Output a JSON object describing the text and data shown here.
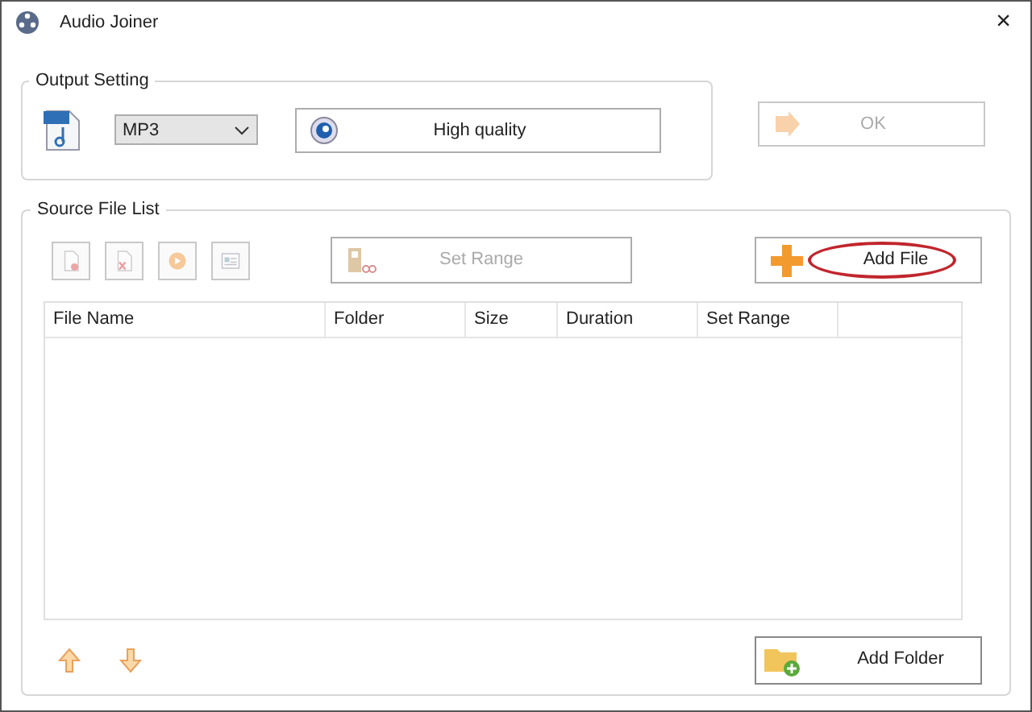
{
  "window": {
    "title": "Audio Joiner",
    "close": "×"
  },
  "output_setting": {
    "legend": "Output Setting",
    "format": "MP3",
    "quality_button": "High quality",
    "ok_button": {
      "label": "OK",
      "disabled": true
    }
  },
  "source_file_list": {
    "legend": "Source File List",
    "toolbar": [
      {
        "kind": "remove",
        "disabled": true
      },
      {
        "kind": "clear",
        "disabled": true
      },
      {
        "kind": "play",
        "disabled": true
      },
      {
        "kind": "properties",
        "disabled": true
      }
    ],
    "set_range_button": {
      "label": "Set Range",
      "disabled": true
    },
    "add_file_button": {
      "label": "Add File",
      "highlighted": true
    },
    "table": {
      "columns": [
        "File Name",
        "Folder",
        "Size",
        "Duration",
        "Set Range"
      ]
    },
    "add_folder_button": {
      "label": "Add Folder"
    }
  }
}
